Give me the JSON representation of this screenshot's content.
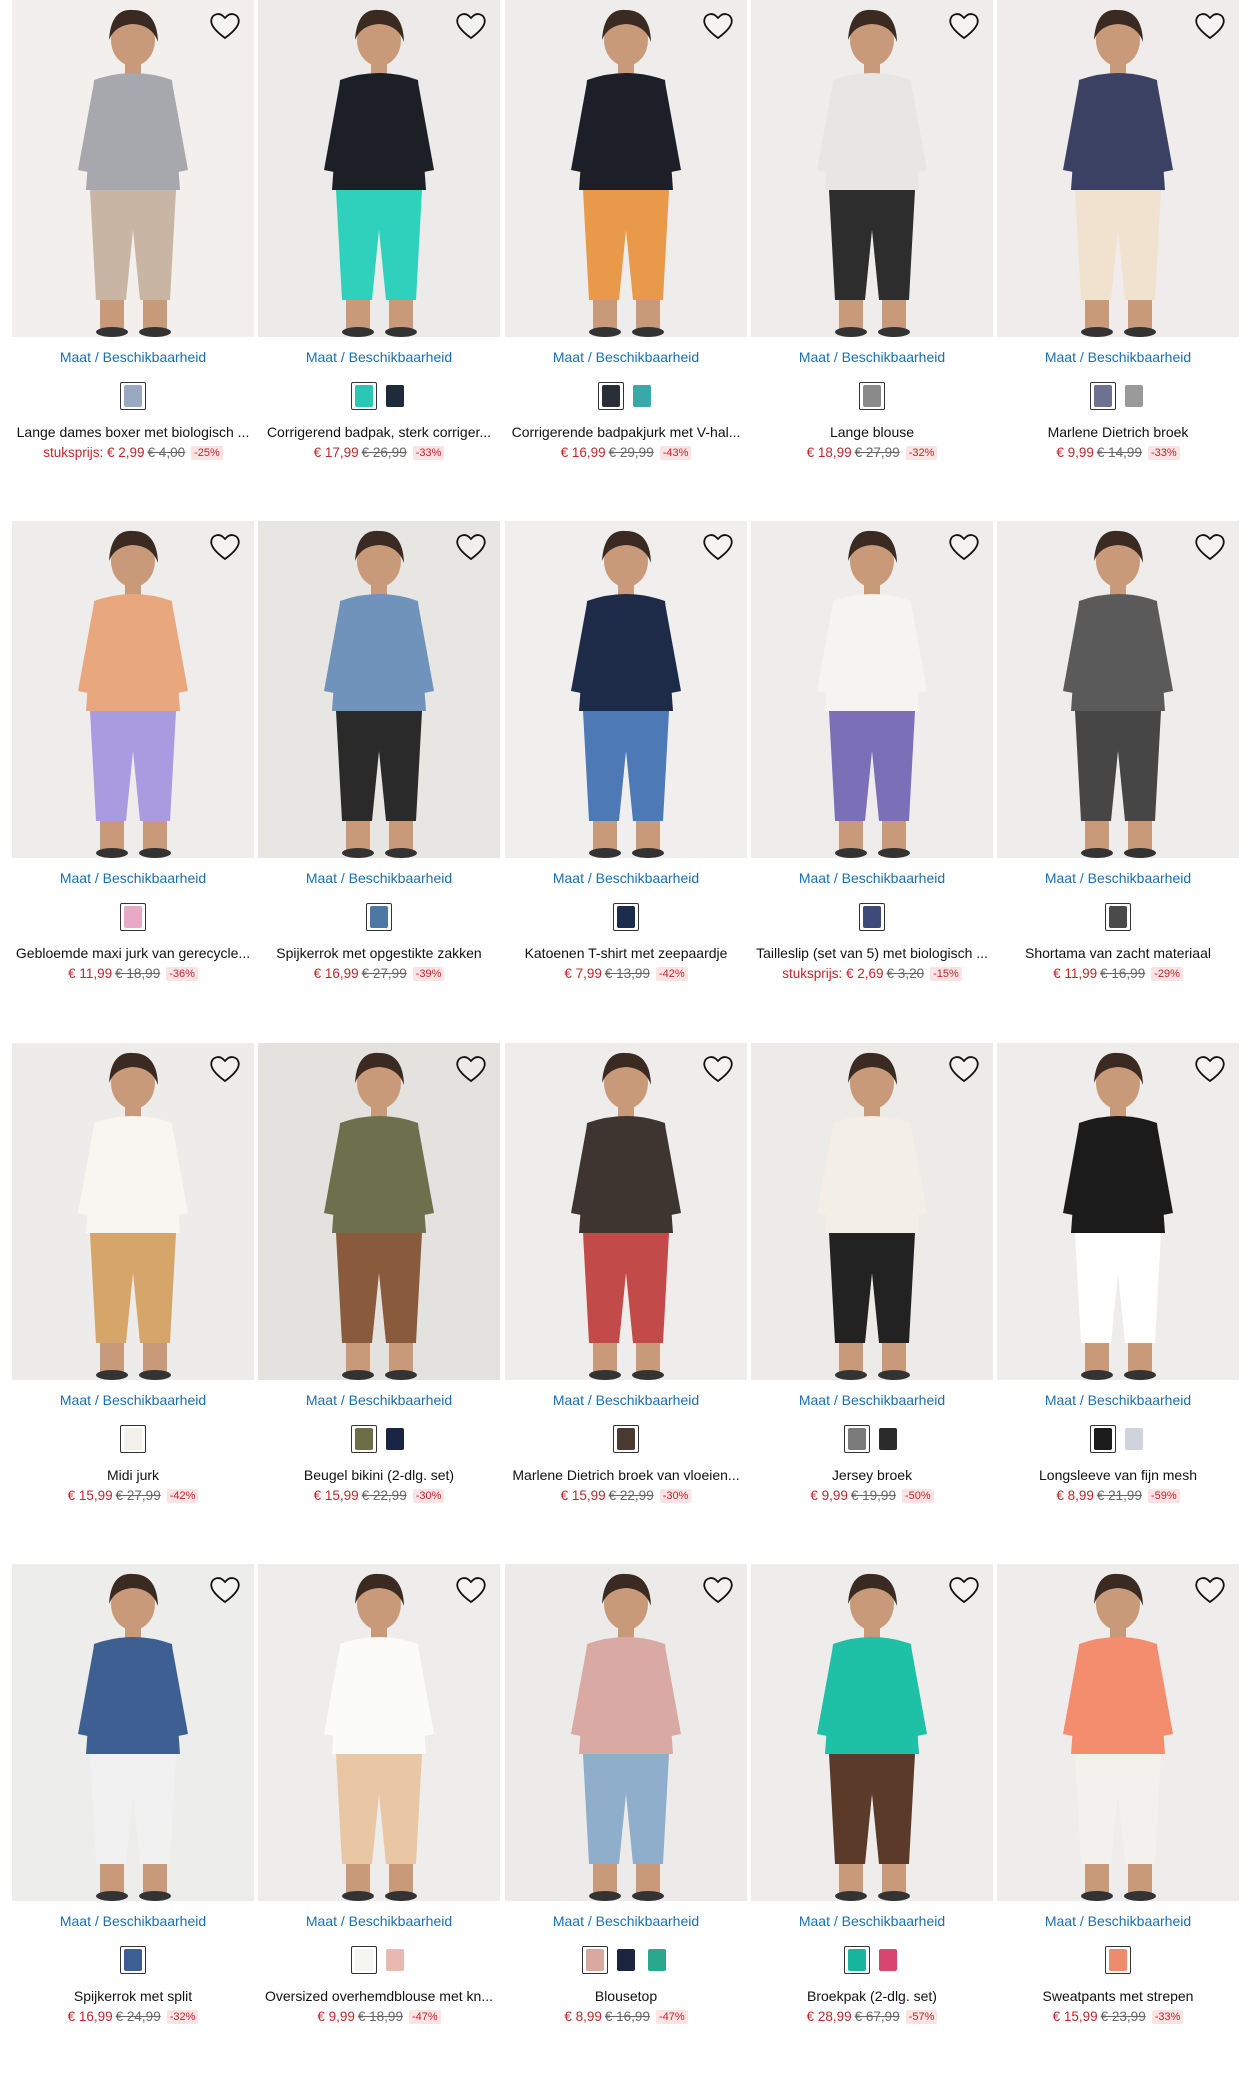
{
  "ui": {
    "size_label": "Maat / Beschikbaarheid"
  },
  "colors": {
    "sale": "#c0262d",
    "link": "#1a6fb0",
    "discount_bg": "#fbe3e4"
  },
  "rows": [
    {
      "products": [
        {
          "name": "Lange dames boxer met biologisch ...",
          "unit_label": "stuksprijs:",
          "price": "€ 2,99",
          "old": "€ 4,00",
          "disc": "-25%",
          "swatches": [
            "#9aa8bf"
          ],
          "palette": [
            "#f2efec",
            "#a7a8ad",
            "#c9b5a4"
          ]
        },
        {
          "name": "Corrigerend badpak, sterk corriger...",
          "price": "€ 17,99",
          "old": "€ 26,99",
          "disc": "-33%",
          "swatches": [
            "#2bc7b5",
            "#1d2b3a"
          ],
          "palette": [
            "#ecebea",
            "#1c1f26",
            "#2fd1bd"
          ]
        },
        {
          "name": "Corrigerende badpakjurk met V-hal...",
          "price": "€ 16,99",
          "old": "€ 29,99",
          "disc": "-43%",
          "swatches": [
            "#2a2e36",
            "#3aa8a8"
          ],
          "palette": [
            "#efedeb",
            "#1c1f27",
            "#e89a4a"
          ]
        },
        {
          "name": "Lange blouse",
          "price": "€ 18,99",
          "old": "€ 27,99",
          "disc": "-32%",
          "swatches": [
            "#8a8a8a"
          ],
          "palette": [
            "#efedec",
            "#e8e6e4",
            "#2d2d2d"
          ]
        },
        {
          "name": "Marlene Dietrich broek",
          "price": "€ 9,99",
          "old": "€ 14,99",
          "disc": "-33%",
          "swatches": [
            "#6c7290",
            "#9a9a9a"
          ],
          "palette": [
            "#efeceb",
            "#3b4162",
            "#f1e2cf"
          ]
        }
      ]
    },
    {
      "products": [
        {
          "name": "Gebloemde maxi jurk van gerecycle...",
          "price": "€ 11,99",
          "old": "€ 18,99",
          "disc": "-36%",
          "swatches": [
            "#e7a9c6"
          ],
          "palette": [
            "#efedec",
            "#e9a77e",
            "#a89be0"
          ]
        },
        {
          "name": "Spijkerrok met opgestikte zakken",
          "price": "€ 16,99",
          "old": "€ 27,99",
          "disc": "-39%",
          "swatches": [
            "#4d78a6"
          ],
          "palette": [
            "#e8e6e3",
            "#6f93bb",
            "#2a2a2a"
          ]
        },
        {
          "name": "Katoenen T-shirt met zeepaardje",
          "price": "€ 7,99",
          "old": "€ 13,99",
          "disc": "-42%",
          "swatches": [
            "#1c2c4d"
          ],
          "palette": [
            "#f0efed",
            "#1d2a48",
            "#4d79b6"
          ]
        },
        {
          "name": "Tailleslip (set van 5) met biologisch ...",
          "unit_label": "stuksprijs:",
          "price": "€ 2,69",
          "old": "€ 3,20",
          "disc": "-15%",
          "swatches": [
            "#3c4b7a"
          ],
          "palette": [
            "#efedeb",
            "#f6f4f0",
            "#7b6fb8"
          ]
        },
        {
          "name": "Shortama van zacht materiaal",
          "price": "€ 11,99",
          "old": "€ 16,99",
          "disc": "-29%",
          "swatches": [
            "#4a4a4a"
          ],
          "palette": [
            "#efedeb",
            "#5a5a5a",
            "#464646"
          ]
        }
      ]
    },
    {
      "products": [
        {
          "name": "Midi jurk",
          "price": "€ 15,99",
          "old": "€ 27,99",
          "disc": "-42%",
          "swatches": [
            "#f4f1ea"
          ],
          "palette": [
            "#eeecea",
            "#f8f6f1",
            "#d6a56a"
          ]
        },
        {
          "name": "Beugel bikini (2-dlg. set)",
          "price": "€ 15,99",
          "old": "€ 22,99",
          "disc": "-30%",
          "swatches": [
            "#6d6e45",
            "#1a2444"
          ],
          "palette": [
            "#e4e2df",
            "#6e6f4c",
            "#8a5a3c"
          ]
        },
        {
          "name": "Marlene Dietrich broek van vloeien...",
          "price": "€ 15,99",
          "old": "€ 22,99",
          "disc": "-30%",
          "swatches": [
            "#4a3a32"
          ],
          "palette": [
            "#efedeb",
            "#3e3530",
            "#c24a48"
          ]
        },
        {
          "name": "Jersey broek",
          "price": "€ 9,99",
          "old": "€ 19,99",
          "disc": "-50%",
          "swatches": [
            "#7a7a7a",
            "#2b2b2b"
          ],
          "palette": [
            "#edebe8",
            "#f3efe6",
            "#222222"
          ]
        },
        {
          "name": "Longsleeve van fijn mesh",
          "price": "€ 8,99",
          "old": "€ 21,99",
          "disc": "-59%",
          "swatches": [
            "#1b1b1b",
            "#cfd3dc"
          ],
          "palette": [
            "#efedeb",
            "#1b1b1b",
            "#ffffff"
          ]
        }
      ]
    },
    {
      "products": [
        {
          "name": "Spijkerrok met split",
          "price": "€ 16,99",
          "old": "€ 24,99",
          "disc": "-32%",
          "swatches": [
            "#3e5f94"
          ],
          "palette": [
            "#ededeb",
            "#3d5f92",
            "#f1f1f1"
          ]
        },
        {
          "name": "Oversized overhemdblouse met kn...",
          "price": "€ 9,99",
          "old": "€ 18,99",
          "disc": "-47%",
          "swatches": [
            "#f5f5f2",
            "#e7b9b0"
          ],
          "palette": [
            "#efedeb",
            "#fbfbf8",
            "#e9c6a4"
          ]
        },
        {
          "name": "Blousetop",
          "price": "€ 8,99",
          "old": "€ 16,99",
          "disc": "-47%",
          "swatches": [
            "#d9a89e",
            "#1c2540",
            "#2aa78c"
          ],
          "palette": [
            "#edebe9",
            "#d9aaa3",
            "#8eaecb"
          ]
        },
        {
          "name": "Broekpak (2-dlg. set)",
          "price": "€ 28,99",
          "old": "€ 67,99",
          "disc": "-57%",
          "swatches": [
            "#18b59d",
            "#d8466f"
          ],
          "palette": [
            "#efedeb",
            "#1fc1a6",
            "#5b3a2a"
          ]
        },
        {
          "name": "Sweatpants met strepen",
          "price": "€ 15,99",
          "old": "€ 23,99",
          "disc": "-33%",
          "swatches": [
            "#f08a6c"
          ],
          "palette": [
            "#efedeb",
            "#f48d6e",
            "#f3f1ee"
          ]
        }
      ]
    }
  ]
}
